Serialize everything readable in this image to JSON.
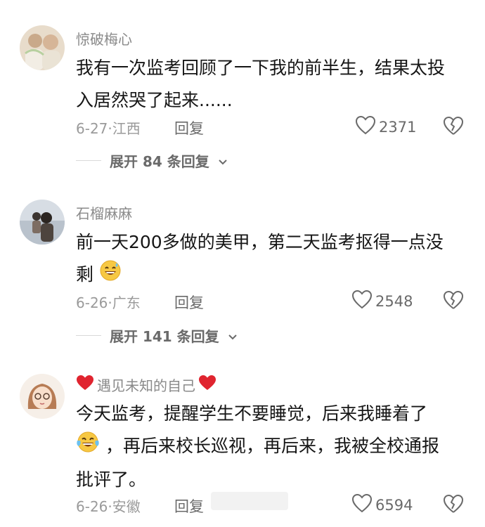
{
  "comments": [
    {
      "username": "惊破梅心",
      "lines": [
        "我有一次监考回顾了一下我的前半生，结果太投",
        "入居然哭了起来......"
      ],
      "date_location": "6-27·江西",
      "reply_label": "回复",
      "likes": "2371",
      "expand_label": "展开 84 条回复"
    },
    {
      "username": "石榴麻麻",
      "lines": [
        "前一天200多做的美甲，第二天监考抠得一点没",
        "剩"
      ],
      "emoji": "sweat-smile-emoji",
      "date_location": "6-26·广东",
      "reply_label": "回复",
      "likes": "2548",
      "expand_label": "展开 141 条回复"
    },
    {
      "username": "遇见未知的自己",
      "lines": [
        "今天监考，提醒学生不要睡觉，后来我睡着了",
        "，再后来校长巡视，再后来，我被全校通报",
        "批评了。"
      ],
      "emoji": "crying-laughing-emoji",
      "date_location": "6-26·安徽",
      "reply_label": "回复",
      "likes": "6594"
    }
  ],
  "colors": {
    "text_primary": "#161616",
    "text_secondary": "#8a8a8a",
    "heart_red": "#e0242f",
    "emoji_yellow": "#f7c843"
  }
}
